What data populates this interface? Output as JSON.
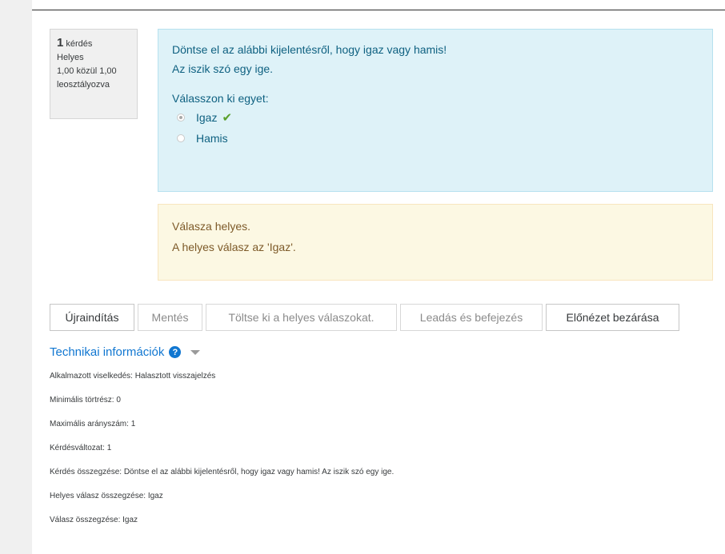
{
  "info": {
    "question_number": "1",
    "question_word": "kérdés",
    "state": "Helyes",
    "grade_line1": "1,00 közül 1,00",
    "grade_line2": "leosztályozva"
  },
  "question": {
    "instruction": "Döntse el az alábbi kijelentésről, hogy igaz vagy hamis!",
    "statement": "Az iszik szó egy ige.",
    "prompt": "Válasszon ki egyet:",
    "options": [
      {
        "label": "Igaz",
        "selected": true,
        "correct_mark": "✔"
      },
      {
        "label": "Hamis",
        "selected": false
      }
    ]
  },
  "feedback": {
    "line1": "Válasza helyes.",
    "line2": "A helyes válasz az 'Igaz'."
  },
  "controls": {
    "restart": "Újraindítás",
    "save": "Mentés",
    "fill_correct": "Töltse ki a helyes válaszokat.",
    "submit_finish": "Leadás és befejezés",
    "close_preview": "Előnézet bezárása"
  },
  "technical": {
    "title": "Technikai információk",
    "help_glyph": "?",
    "lines": [
      "Alkalmazott viselkedés: Halasztott visszajelzés",
      "Minimális törtrész: 0",
      "Maximális arányszám: 1",
      "Kérdésváltozat: 1",
      "Kérdés összegzése: Döntse el az alábbi kijelentésről, hogy igaz vagy hamis! Az iszik szó egy ige.",
      "Helyes válasz összegzése: Igaz",
      "Válasz összegzése: Igaz"
    ]
  },
  "colors": {
    "formulation_bg": "#def2f8",
    "formulation_text": "#0f6181",
    "feedback_bg": "#fcf8e3",
    "feedback_text": "#7d5a29",
    "link_blue": "#1177d1",
    "correct_green": "#5aa02c"
  }
}
